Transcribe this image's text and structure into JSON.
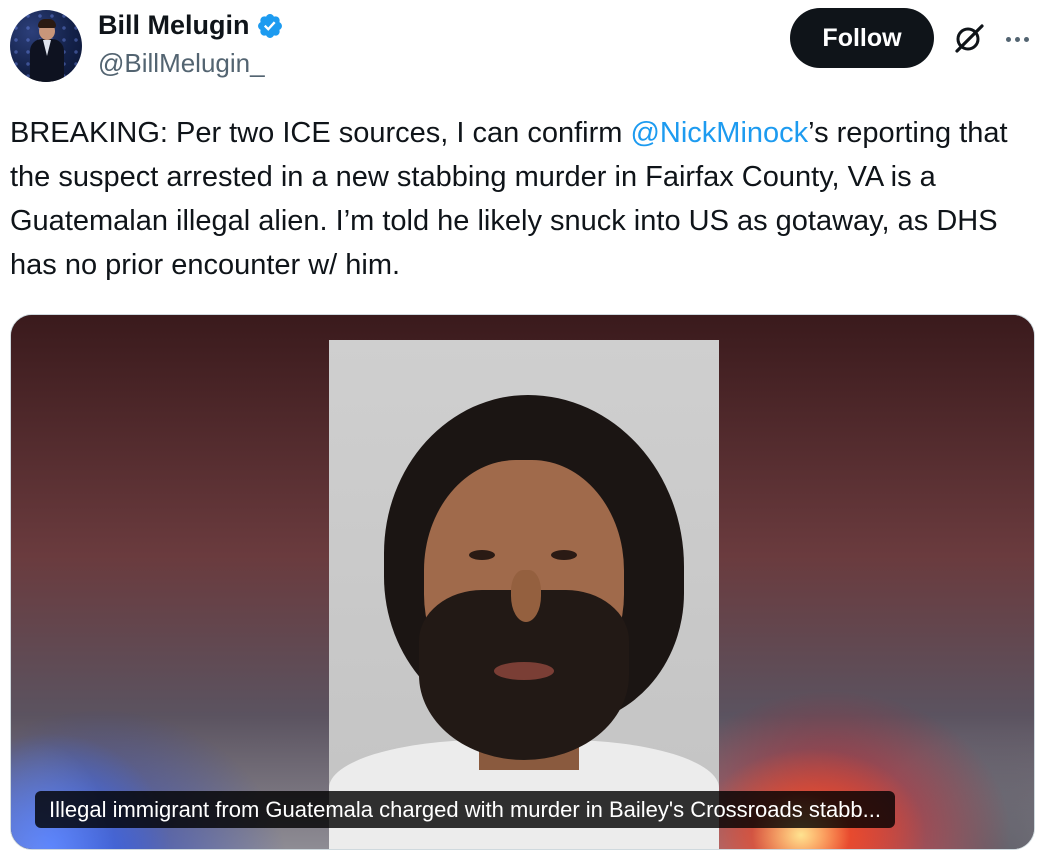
{
  "author": {
    "display_name": "Bill Melugin",
    "handle": "@BillMelugin_",
    "verified_icon": "verified-badge-icon"
  },
  "actions": {
    "follow_label": "Follow",
    "grok_icon": "grok-icon",
    "more_icon": "more-icon"
  },
  "tweet": {
    "text_before_mention": "BREAKING: Per two ICE sources, I can confirm ",
    "mention": "@NickMinock",
    "text_after_mention": "’s reporting that the suspect arrested in a new stabbing murder in Fairfax County, VA is a Guatemalan illegal alien. I’m told he likely snuck into US as gotaway, as DHS has no prior encounter w/ him."
  },
  "media": {
    "caption": "Illegal immigrant from Guatemala charged with murder in Bailey's Crossroads stabb..."
  },
  "colors": {
    "accent": "#1d9bf0",
    "text": "#0f1419",
    "secondary_text": "#536471",
    "follow_bg": "#0f1419"
  }
}
